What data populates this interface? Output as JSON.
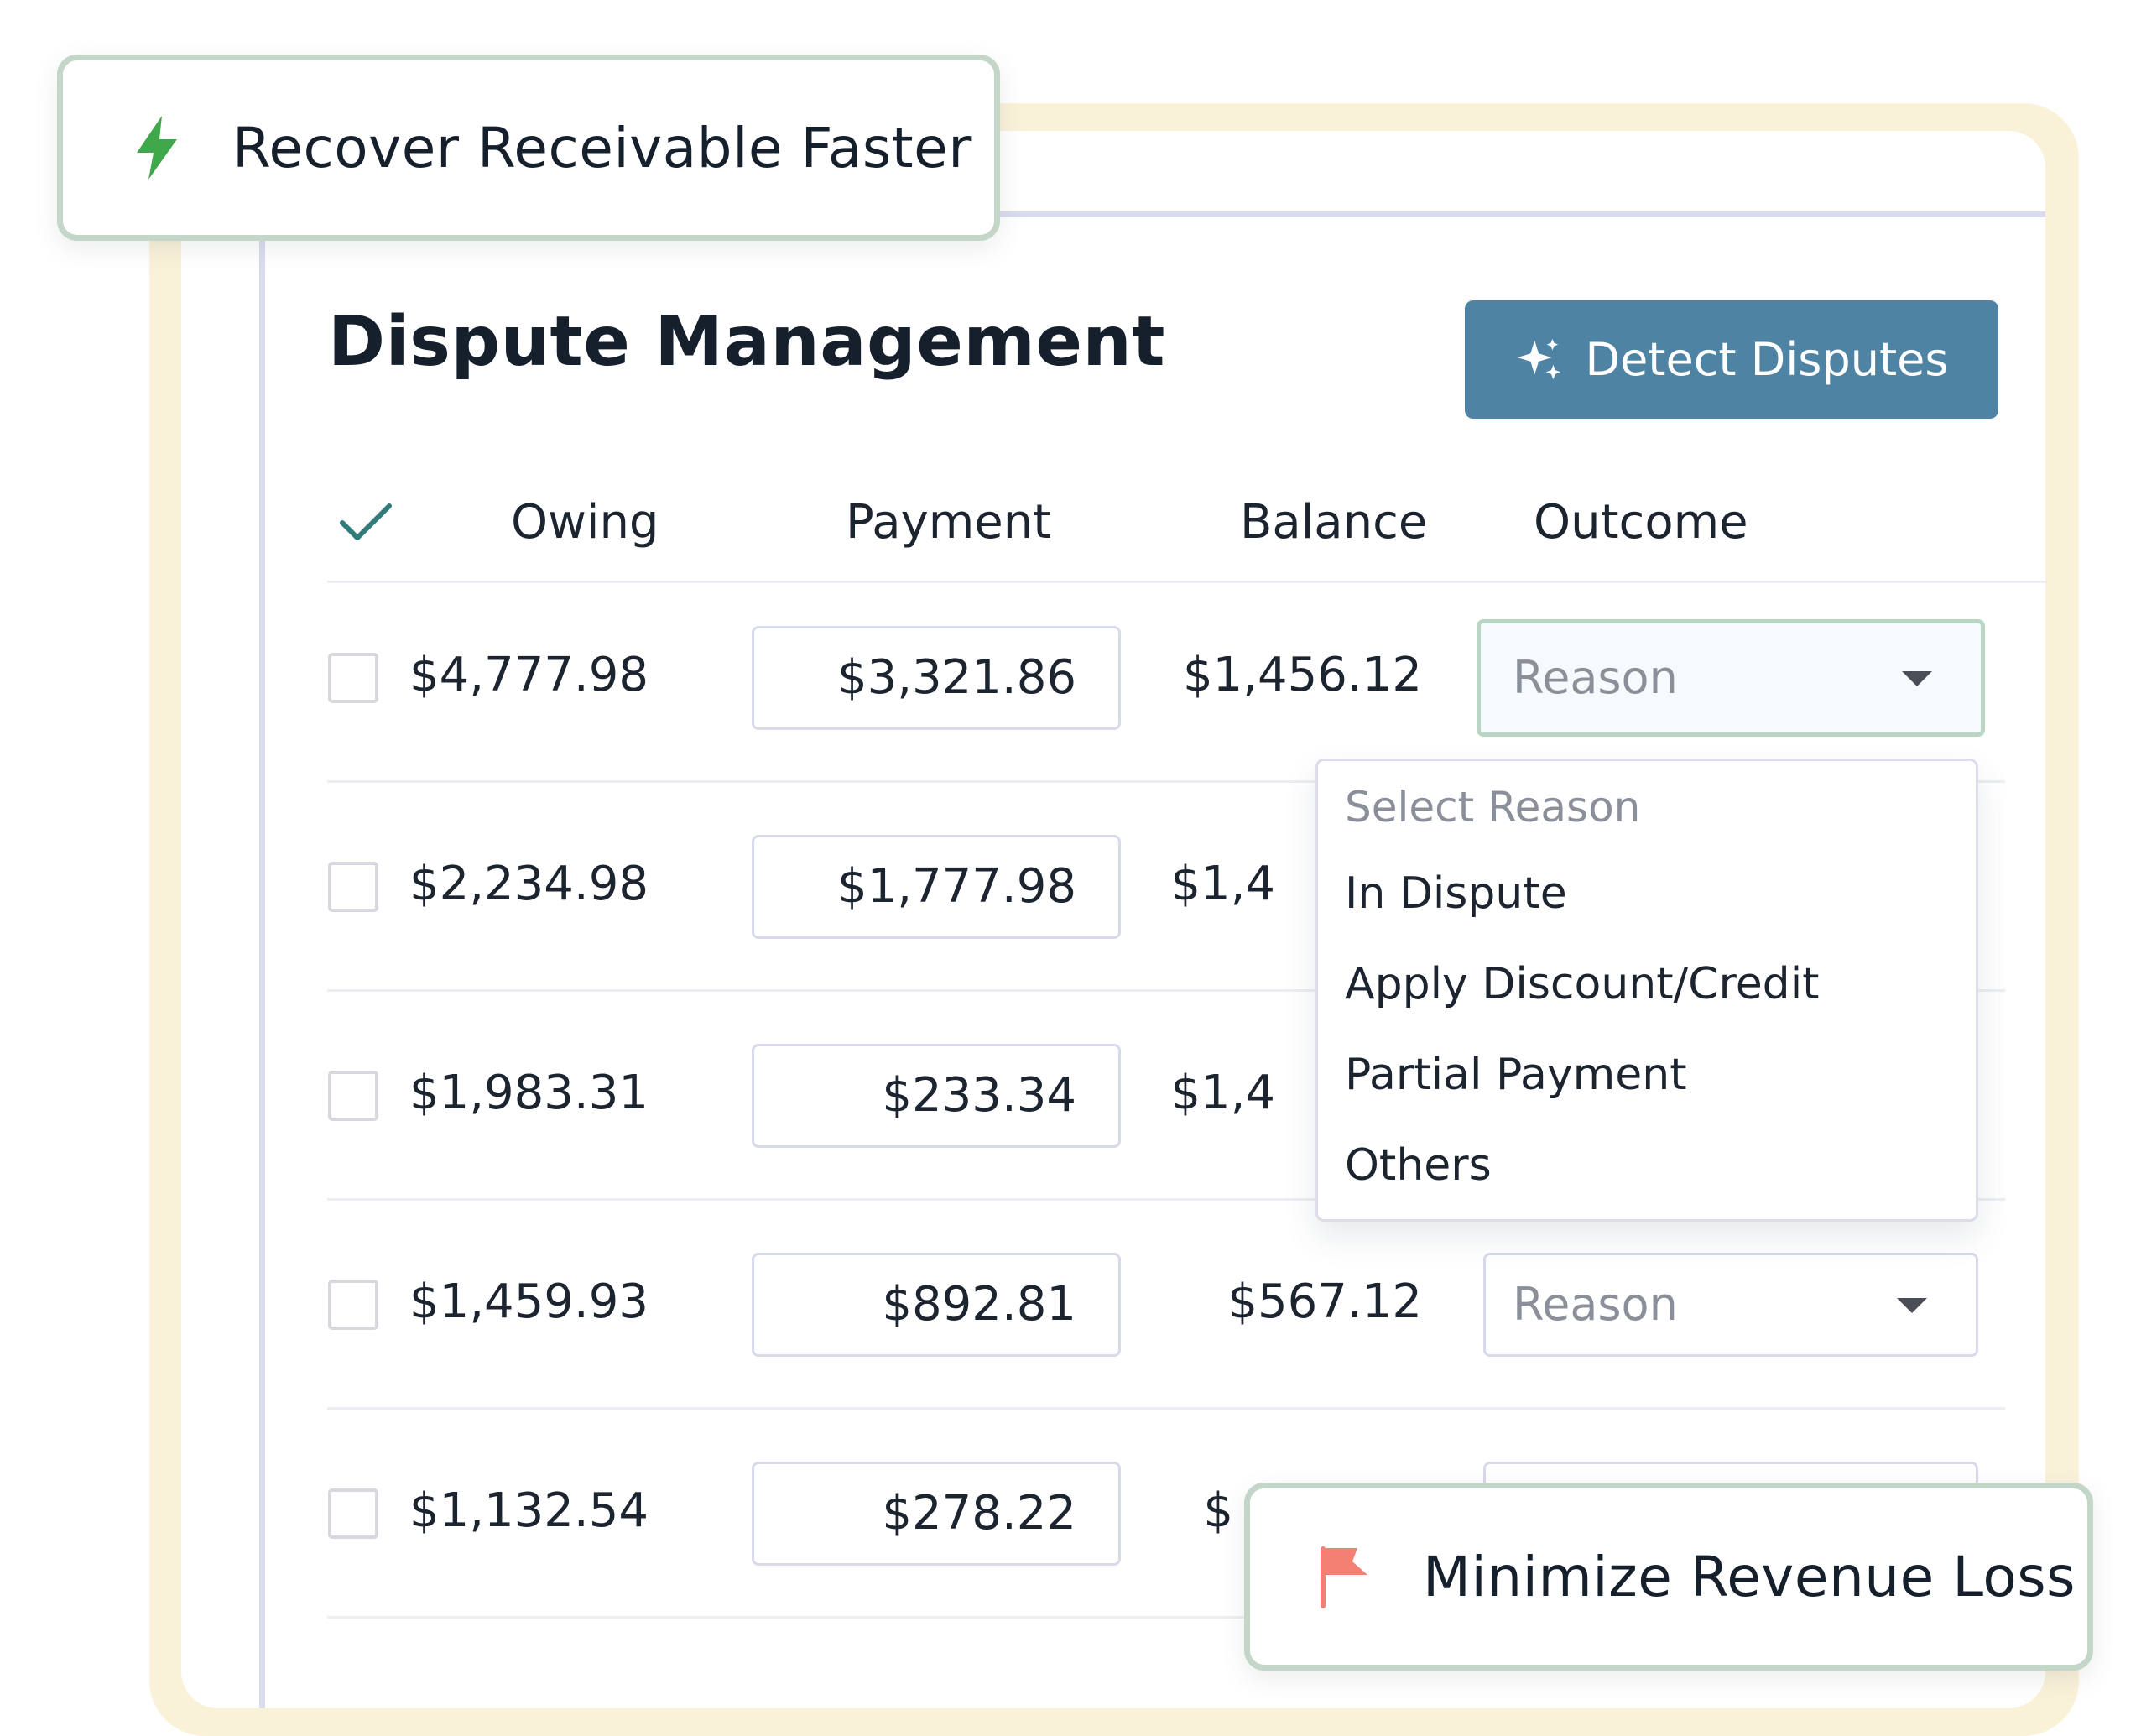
{
  "badges": {
    "top": {
      "label": "Recover Receivable Faster",
      "icon": "lightning-bolt-icon"
    },
    "bottom": {
      "label": "Minimize Revenue Loss",
      "icon": "flag-icon"
    }
  },
  "page_title": "Dispute Management",
  "detect_button": {
    "label": "Detect Disputes",
    "icon": "sparkle-icon"
  },
  "table": {
    "headers": {
      "owing": "Owing",
      "payment": "Payment",
      "balance": "Balance",
      "outcome": "Outcome"
    },
    "rows": [
      {
        "owing": "$4,777.98",
        "payment": "$3,321.86",
        "balance": "$1,456.12",
        "outcome": "Reason"
      },
      {
        "owing": "$2,234.98",
        "payment": "$1,777.98",
        "balance": "$1,4",
        "outcome": ""
      },
      {
        "owing": "$1,983.31",
        "payment": "$233.34",
        "balance": "$1,4",
        "outcome": ""
      },
      {
        "owing": "$1,459.93",
        "payment": "$892.81",
        "balance": "$567.12",
        "outcome": "Reason"
      },
      {
        "owing": "$1,132.54",
        "payment": "$278.22",
        "balance": "$",
        "outcome": ""
      }
    ]
  },
  "dropdown": {
    "placeholder": "Select Reason",
    "options": [
      "In Dispute",
      "Apply Discount/Credit",
      "Partial Payment",
      "Others"
    ]
  },
  "colors": {
    "accent_button": "#4f83a3",
    "frame": "#faf1d9",
    "badge_border": "#c3d6c8",
    "bolt": "#3fa84a",
    "flag": "#f47f73",
    "check": "#2f7c78"
  }
}
